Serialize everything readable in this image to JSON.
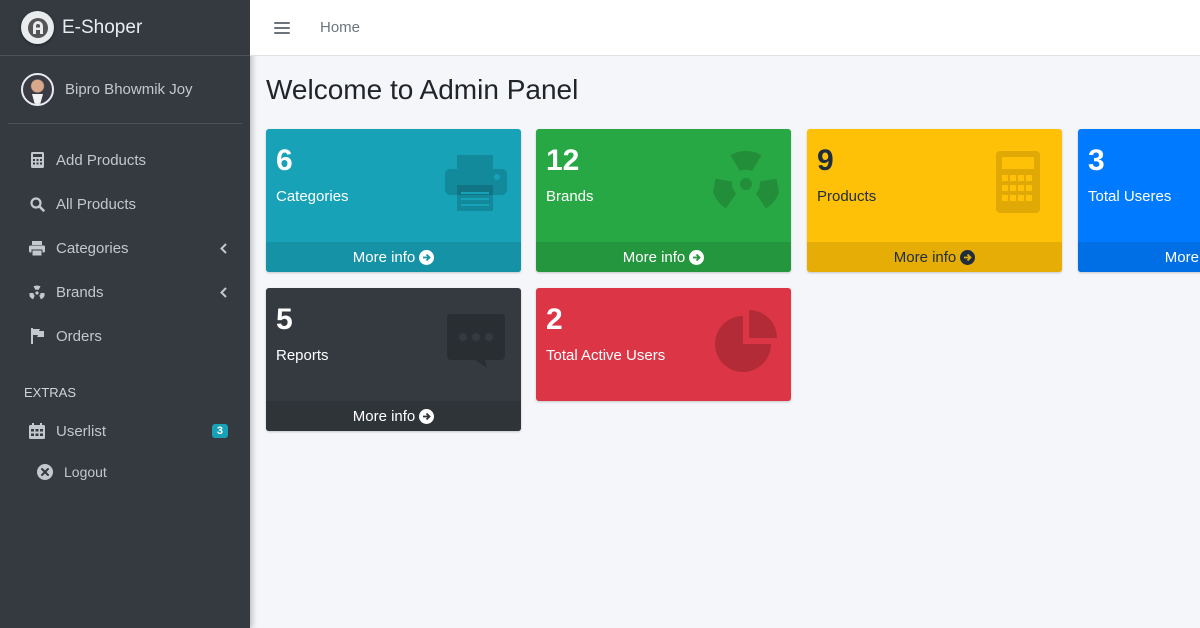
{
  "brand": {
    "name": "E-Shoper",
    "logo_icon": "brand-logo-icon"
  },
  "user": {
    "name": "Bipro Bhowmik Joy"
  },
  "sidebar": {
    "items": [
      {
        "label": "Add Products",
        "icon": "calculator-icon"
      },
      {
        "label": "All Products",
        "icon": "search-icon"
      },
      {
        "label": "Categories",
        "icon": "print-icon",
        "expandable": true
      },
      {
        "label": "Brands",
        "icon": "radiation-icon",
        "expandable": true
      },
      {
        "label": "Orders",
        "icon": "flag-icon"
      }
    ],
    "extras_header": "EXTRAS",
    "userlist": {
      "label": "Userlist",
      "badge": "3",
      "icon": "calendar-icon"
    },
    "logout": {
      "label": "Logout",
      "icon": "times-circle-icon"
    }
  },
  "topbar": {
    "home_label": "Home"
  },
  "page": {
    "title": "Welcome to Admin Panel"
  },
  "boxes": [
    {
      "count": "6",
      "label": "Categories",
      "more": "More info",
      "color": "#17a2b8",
      "icon": "print-icon"
    },
    {
      "count": "12",
      "label": "Brands",
      "more": "More info",
      "color": "#28a745",
      "icon": "radiation-icon"
    },
    {
      "count": "9",
      "label": "Products",
      "more": "More info",
      "color": "#ffc107",
      "icon": "calculator-icon"
    },
    {
      "count": "3",
      "label": "Total Useres",
      "more": "More info",
      "color": "#007bff",
      "icon": "users-icon"
    },
    {
      "count": "5",
      "label": "Reports",
      "more": "More info",
      "color": "#343a40",
      "icon": "comment-dots-icon"
    },
    {
      "count": "2",
      "label": "Total Active Users",
      "color": "#dc3545",
      "icon": "chart-pie-icon"
    }
  ]
}
